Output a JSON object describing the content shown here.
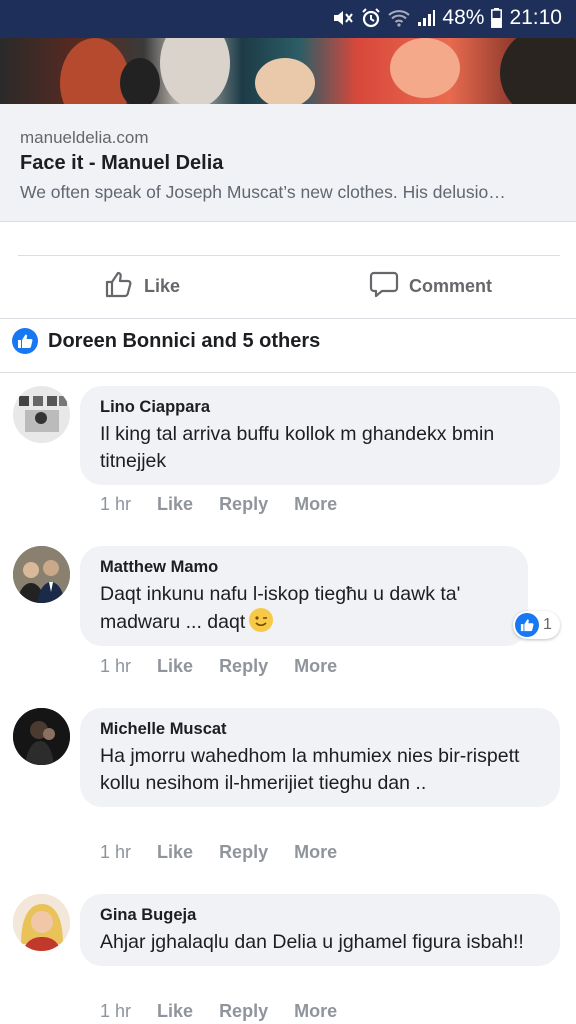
{
  "status_bar": {
    "battery": "48%",
    "time": "21:10"
  },
  "link_preview": {
    "domain": "manueldelia.com",
    "title": "Face it - Manuel Delia",
    "description": "We often speak of Joseph Muscat’s new clothes. His delusio…"
  },
  "actions": {
    "like": "Like",
    "comment": "Comment"
  },
  "reactions": {
    "summary": "Doreen Bonnici and 5 others"
  },
  "comments": [
    {
      "author": "Lino Ciappara",
      "text": "Il king tal arriva buffu kollok m ghandekx bmin titnejjek",
      "time": "1 hr",
      "like": "Like",
      "reply": "Reply",
      "more": "More"
    },
    {
      "author": "Matthew Mamo",
      "text": "Daqt inkunu nafu l-iskop tiegħu u dawk ta' madwaru ... daqt",
      "time": "1 hr",
      "like": "Like",
      "reply": "Reply",
      "more": "More",
      "reaction_count": "1"
    },
    {
      "author": "Michelle Muscat",
      "text": "Ha jmorru wahedhom la mhumiex nies bir-rispett kollu nesihom il-hmerijiet tieghu dan ..",
      "time": "1 hr",
      "like": "Like",
      "reply": "Reply",
      "more": "More"
    },
    {
      "author": "Gina Bugeja",
      "text": "Ahjar jghalaqlu dan Delia u jghamel figura isbah!!",
      "time": "1 hr",
      "like": "Like",
      "reply": "Reply",
      "more": "More"
    }
  ],
  "colors": {
    "status_bar": "#1e3059",
    "accent": "#1877f2",
    "bubble": "#f0f2f5",
    "meta": "#8d949e"
  }
}
